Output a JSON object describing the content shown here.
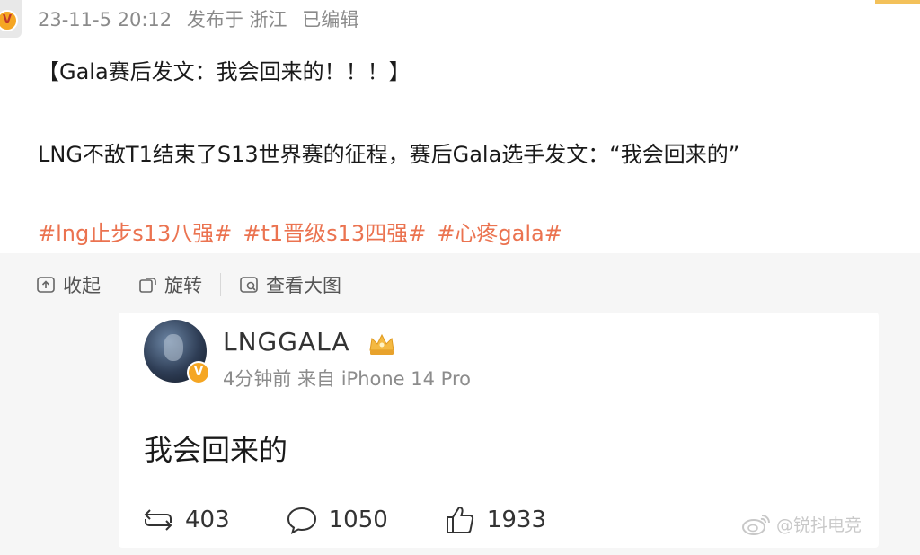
{
  "post": {
    "timestamp": "23-11-5 20:12",
    "published_label": "发布于 浙江",
    "edited_label": "已编辑",
    "headline": "【Gala赛后发文：我会回来的！！！】",
    "body": "LNG不敌T1结束了S13世界赛的征程，赛后Gala选手发文：“我会回来的”",
    "tags": [
      "#lng止步s13八强#",
      "#t1晋级s13四强#",
      "#心疼gala#"
    ]
  },
  "actions": {
    "collapse_label": "收起",
    "rotate_label": "旋转",
    "view_large_label": "查看大图"
  },
  "embedded_post": {
    "username": "LNGGALA",
    "meta": "4分钟前 来自 iPhone 14 Pro",
    "text": "我会回来的",
    "reposts": "403",
    "comments": "1050",
    "likes": "1933"
  },
  "watermark": {
    "text": "@锐抖电竞"
  },
  "colors": {
    "tag": "#eb7350",
    "meta": "#8a8a8a",
    "repost_bg": "#f6f6f6",
    "verified_badge": "#f5a623"
  }
}
